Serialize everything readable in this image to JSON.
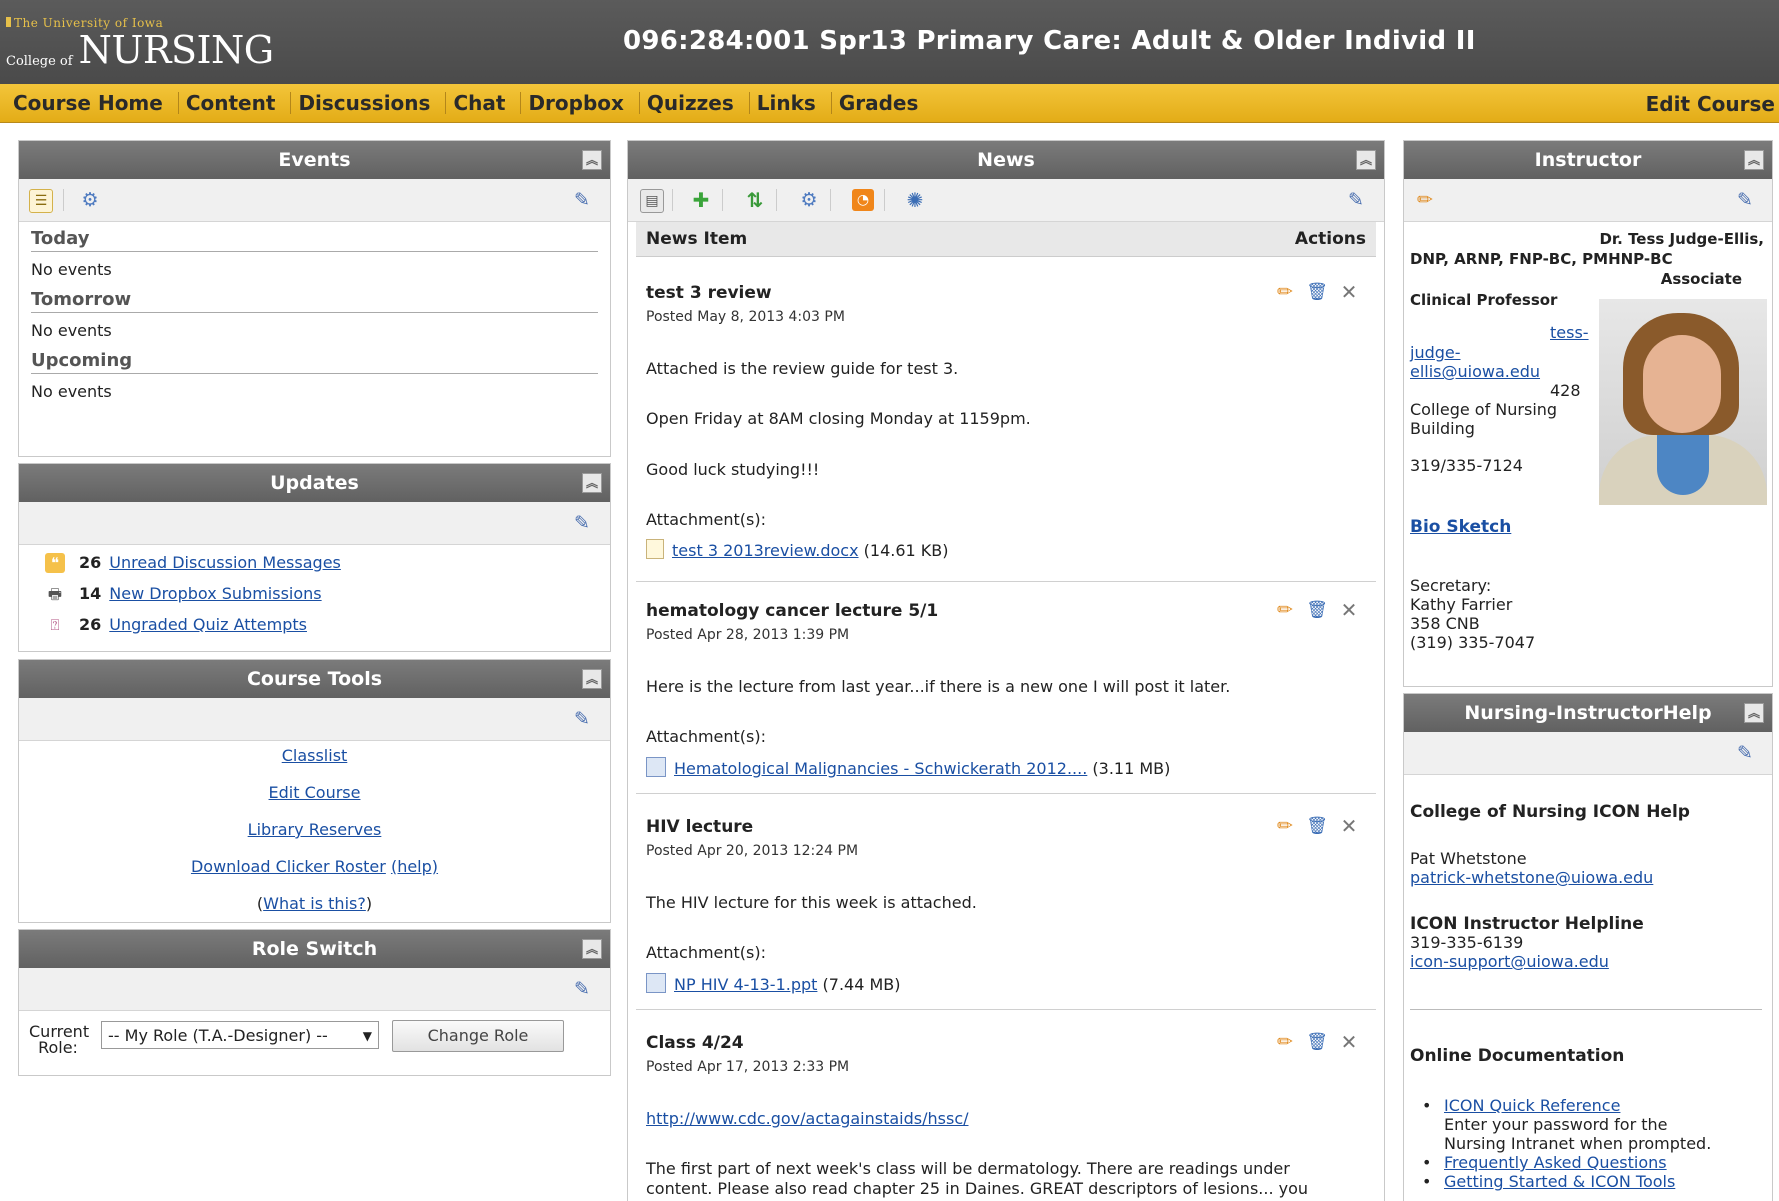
{
  "header": {
    "logo_university": "The University of Iowa",
    "logo_college_of": "College of",
    "logo_nursing": "NURSING",
    "course_title": "096:284:001 Spr13 Primary Care: Adult & Older Individ II"
  },
  "nav": {
    "items": [
      "Course Home",
      "Content",
      "Discussions",
      "Chat",
      "Dropbox",
      "Quizzes",
      "Links",
      "Grades"
    ],
    "edit_course": "Edit Course"
  },
  "events": {
    "title": "Events",
    "sections": [
      {
        "heading": "Today",
        "text": "No events"
      },
      {
        "heading": "Tomorrow",
        "text": "No events"
      },
      {
        "heading": "Upcoming",
        "text": "No events"
      }
    ]
  },
  "updates": {
    "title": "Updates",
    "rows": [
      {
        "count": "26",
        "label": "Unread Discussion Messages",
        "icon": "discussion-icon"
      },
      {
        "count": "14",
        "label": "New Dropbox Submissions",
        "icon": "dropbox-icon"
      },
      {
        "count": "26",
        "label": "Ungraded Quiz Attempts",
        "icon": "quiz-icon"
      }
    ]
  },
  "course_tools": {
    "title": "Course Tools",
    "links": [
      "Classlist",
      "Edit Course",
      "Library Reserves",
      "Download Clicker Roster"
    ],
    "help": "(help)",
    "what_prefix": "(",
    "what_is_this": "What is this?",
    "what_suffix": ")"
  },
  "role_switch": {
    "title": "Role Switch",
    "label": "Current Role:",
    "selected": "-- My Role (T.A.-Designer) --",
    "button": "Change Role"
  },
  "news": {
    "title": "News",
    "col_item": "News Item",
    "col_actions": "Actions",
    "items": [
      {
        "title": "test 3 review",
        "posted": "Posted May 8, 2013 4:03 PM",
        "body": [
          "Attached is the review guide for test 3.",
          "Open Friday at 8AM closing Monday at 1159pm.",
          "Good luck studying!!!"
        ],
        "attach_label": "Attachment(s):",
        "file": "test 3 2013review.docx",
        "size": "(14.61 KB)"
      },
      {
        "title": "hematology cancer lecture 5/1",
        "posted": "Posted Apr 28, 2013 1:39 PM",
        "body": [
          "Here is the lecture from last year...if there is a new one I will post it later."
        ],
        "attach_label": "Attachment(s):",
        "file": "Hematological Malignancies - Schwickerath 2012....",
        "size": "(3.11 MB)"
      },
      {
        "title": "HIV lecture",
        "posted": "Posted Apr 20, 2013 12:24 PM",
        "body": [
          "The HIV lecture for this week is attached."
        ],
        "attach_label": "Attachment(s):",
        "file": "NP HIV 4-13-1.ppt",
        "size": "(7.44 MB)"
      },
      {
        "title": "Class 4/24",
        "posted": "Posted Apr 17, 2013 2:33 PM",
        "link": "http://www.cdc.gov/actagainstaids/hssc/",
        "body": [
          "The first part of next week's class will be dermatology.  There are readings under",
          "content.  Please also read chapter 25 in Daines.  GREAT descriptors of lesions... you"
        ]
      }
    ]
  },
  "instructor": {
    "title": "Instructor",
    "name_line1": "Dr. Tess Judge-Ellis,",
    "name_line2": "DNP, ARNP, FNP-BC, PMHNP-BC",
    "title_line1": "Associate",
    "title_line2": "Clinical Professor",
    "email_1": "tess-",
    "email_2": "judge-",
    "email_3": "ellis@uiowa.edu",
    "room": "428",
    "building_1": "College of Nursing",
    "building_2": "Building",
    "phone": "319/335-7124",
    "bio": "Bio Sketch",
    "secretary_label": "Secretary:",
    "secretary_name": "Kathy Farrier",
    "secretary_room": "358 CNB",
    "secretary_phone": "(319) 335-7047"
  },
  "help": {
    "title": "Nursing-InstructorHelp",
    "con_title": "College of Nursing ICON Help",
    "con_name": "Pat Whetstone",
    "con_email": "patrick-whetstone@uiowa.edu",
    "line_title": "ICON Instructor Helpline",
    "line_phone": "319-335-6139",
    "line_email": "icon-support@uiowa.edu",
    "docs_title": "Online Documentation",
    "doc1": "ICON Quick Reference",
    "doc1_note1": "Enter your password for the",
    "doc1_note2": "Nursing Intranet when prompted.",
    "doc2": "Frequently Asked Questions",
    "doc3": "Getting Started & ICON Tools"
  }
}
